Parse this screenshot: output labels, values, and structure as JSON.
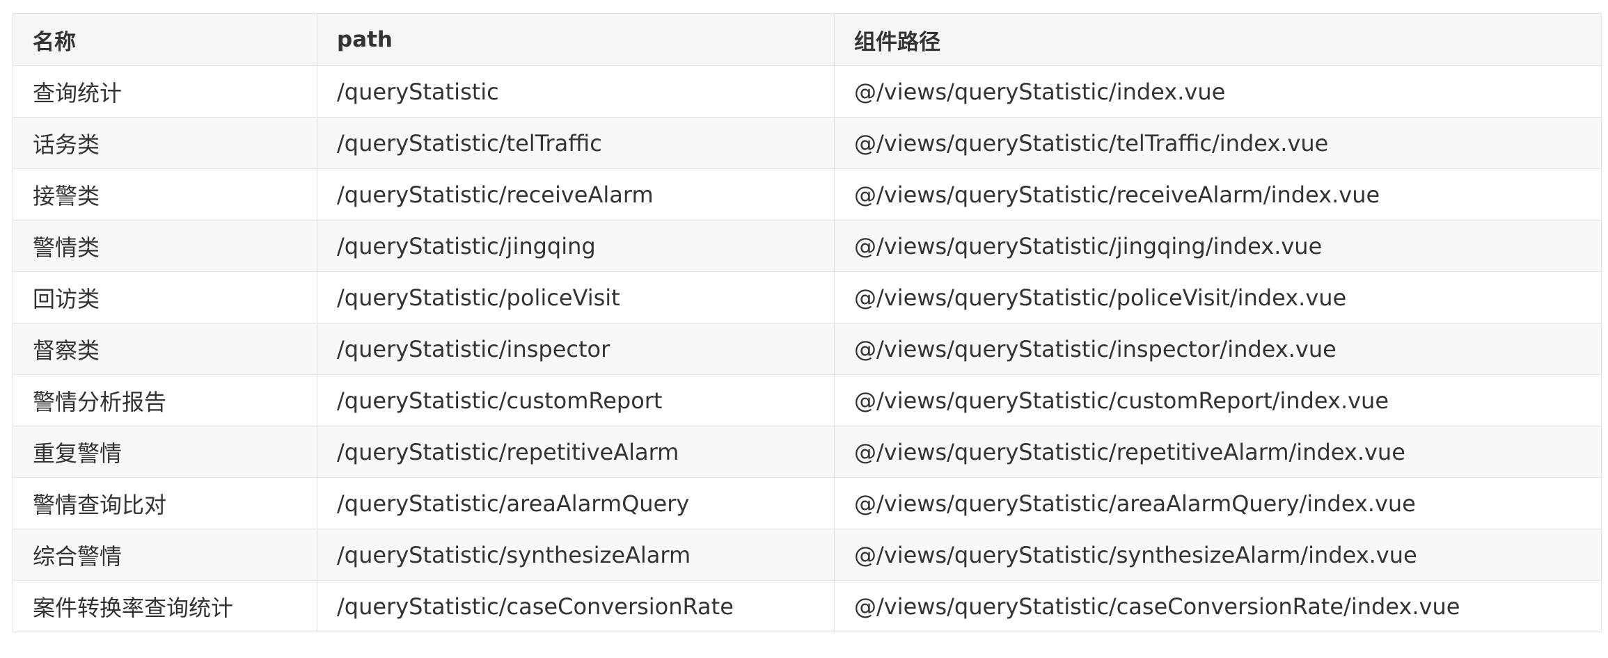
{
  "table": {
    "headers": [
      "名称",
      "path",
      "组件路径"
    ],
    "rows": [
      [
        "查询统计",
        "/queryStatistic",
        "@/views/queryStatistic/index.vue"
      ],
      [
        "话务类",
        "/queryStatistic/telTraffic",
        "@/views/queryStatistic/telTraffic/index.vue"
      ],
      [
        "接警类",
        "/queryStatistic/receiveAlarm",
        "@/views/queryStatistic/receiveAlarm/index.vue"
      ],
      [
        "警情类",
        "/queryStatistic/jingqing",
        "@/views/queryStatistic/jingqing/index.vue"
      ],
      [
        "回访类",
        "/queryStatistic/policeVisit",
        "@/views/queryStatistic/policeVisit/index.vue"
      ],
      [
        "督察类",
        "/queryStatistic/inspector",
        "@/views/queryStatistic/inspector/index.vue"
      ],
      [
        "警情分析报告",
        "/queryStatistic/customReport",
        "@/views/queryStatistic/customReport/index.vue"
      ],
      [
        "重复警情",
        "/queryStatistic/repetitiveAlarm",
        "@/views/queryStatistic/repetitiveAlarm/index.vue"
      ],
      [
        "警情查询比对",
        "/queryStatistic/areaAlarmQuery",
        "@/views/queryStatistic/areaAlarmQuery/index.vue"
      ],
      [
        "综合警情",
        "/queryStatistic/synthesizeAlarm",
        "@/views/queryStatistic/synthesizeAlarm/index.vue"
      ],
      [
        "案件转换率查询统计",
        "/queryStatistic/caseConversionRate",
        "@/views/queryStatistic/caseConversionRate/index.vue"
      ]
    ]
  }
}
